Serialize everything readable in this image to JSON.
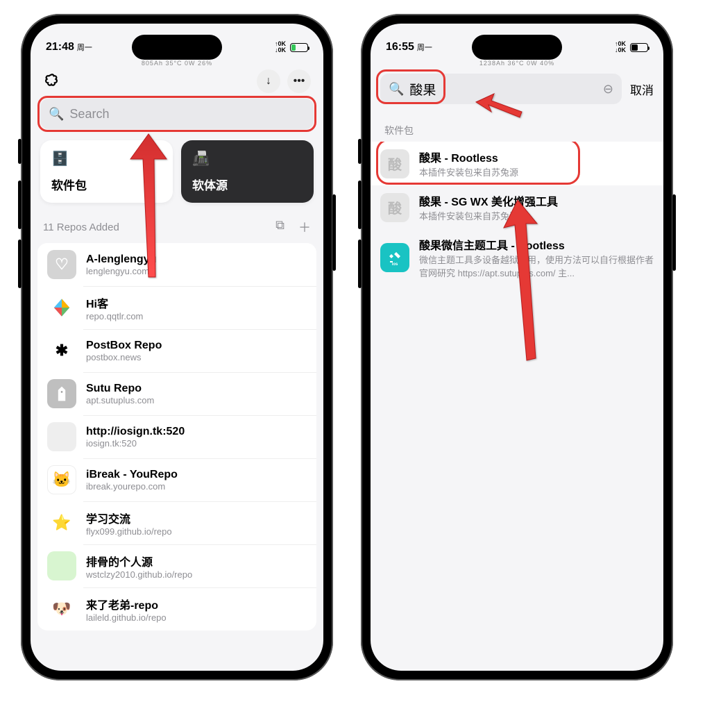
{
  "left": {
    "status": {
      "time": "21:48",
      "day": "周一",
      "small": "805Ah  35°C  0W  26%",
      "tok": "↑0K\n↓0K",
      "bat": "20"
    },
    "search_placeholder": "Search",
    "cards": {
      "packages": "软件包",
      "sources": "软体源"
    },
    "section": {
      "label": "11 Repos Added"
    },
    "repos": [
      {
        "title": "A-lenglengyu",
        "sub": "lenglengyu.com"
      },
      {
        "title": "Hi客",
        "sub": "repo.qqtlr.com"
      },
      {
        "title": "PostBox Repo",
        "sub": "postbox.news"
      },
      {
        "title": "Sutu Repo",
        "sub": "apt.sutuplus.com"
      },
      {
        "title": "http://iosign.tk:520",
        "sub": "iosign.tk:520"
      },
      {
        "title": "iBreak - YouRepo",
        "sub": "ibreak.yourepo.com"
      },
      {
        "title": "学习交流",
        "sub": "flyx099.github.io/repo"
      },
      {
        "title": "排骨的个人源",
        "sub": "wstclzy2010.github.io/repo"
      },
      {
        "title": "来了老弟-repo",
        "sub": "laileld.github.io/repo"
      }
    ]
  },
  "right": {
    "status": {
      "time": "16:55",
      "day": "周一",
      "small": "1238Ah  36°C  0W  40%",
      "tok": "↑0K\n↓0K",
      "bat": "40"
    },
    "search_value": "酸果",
    "cancel": "取消",
    "section": "软件包",
    "results": [
      {
        "title": "酸果 - Rootless",
        "sub": "本插件安装包来自苏兔源",
        "glyph": "酸"
      },
      {
        "title": "酸果 - SG WX 美化增强工具",
        "sub": "本插件安装包来自苏兔源",
        "glyph": "酸"
      },
      {
        "title": "酸果微信主题工具 - Rootless",
        "sub": "微信主题工具多设备越狱专用，使用方法可以自行根据作者官网研究 https://apt.sutuplus.com/ 主..."
      }
    ]
  }
}
